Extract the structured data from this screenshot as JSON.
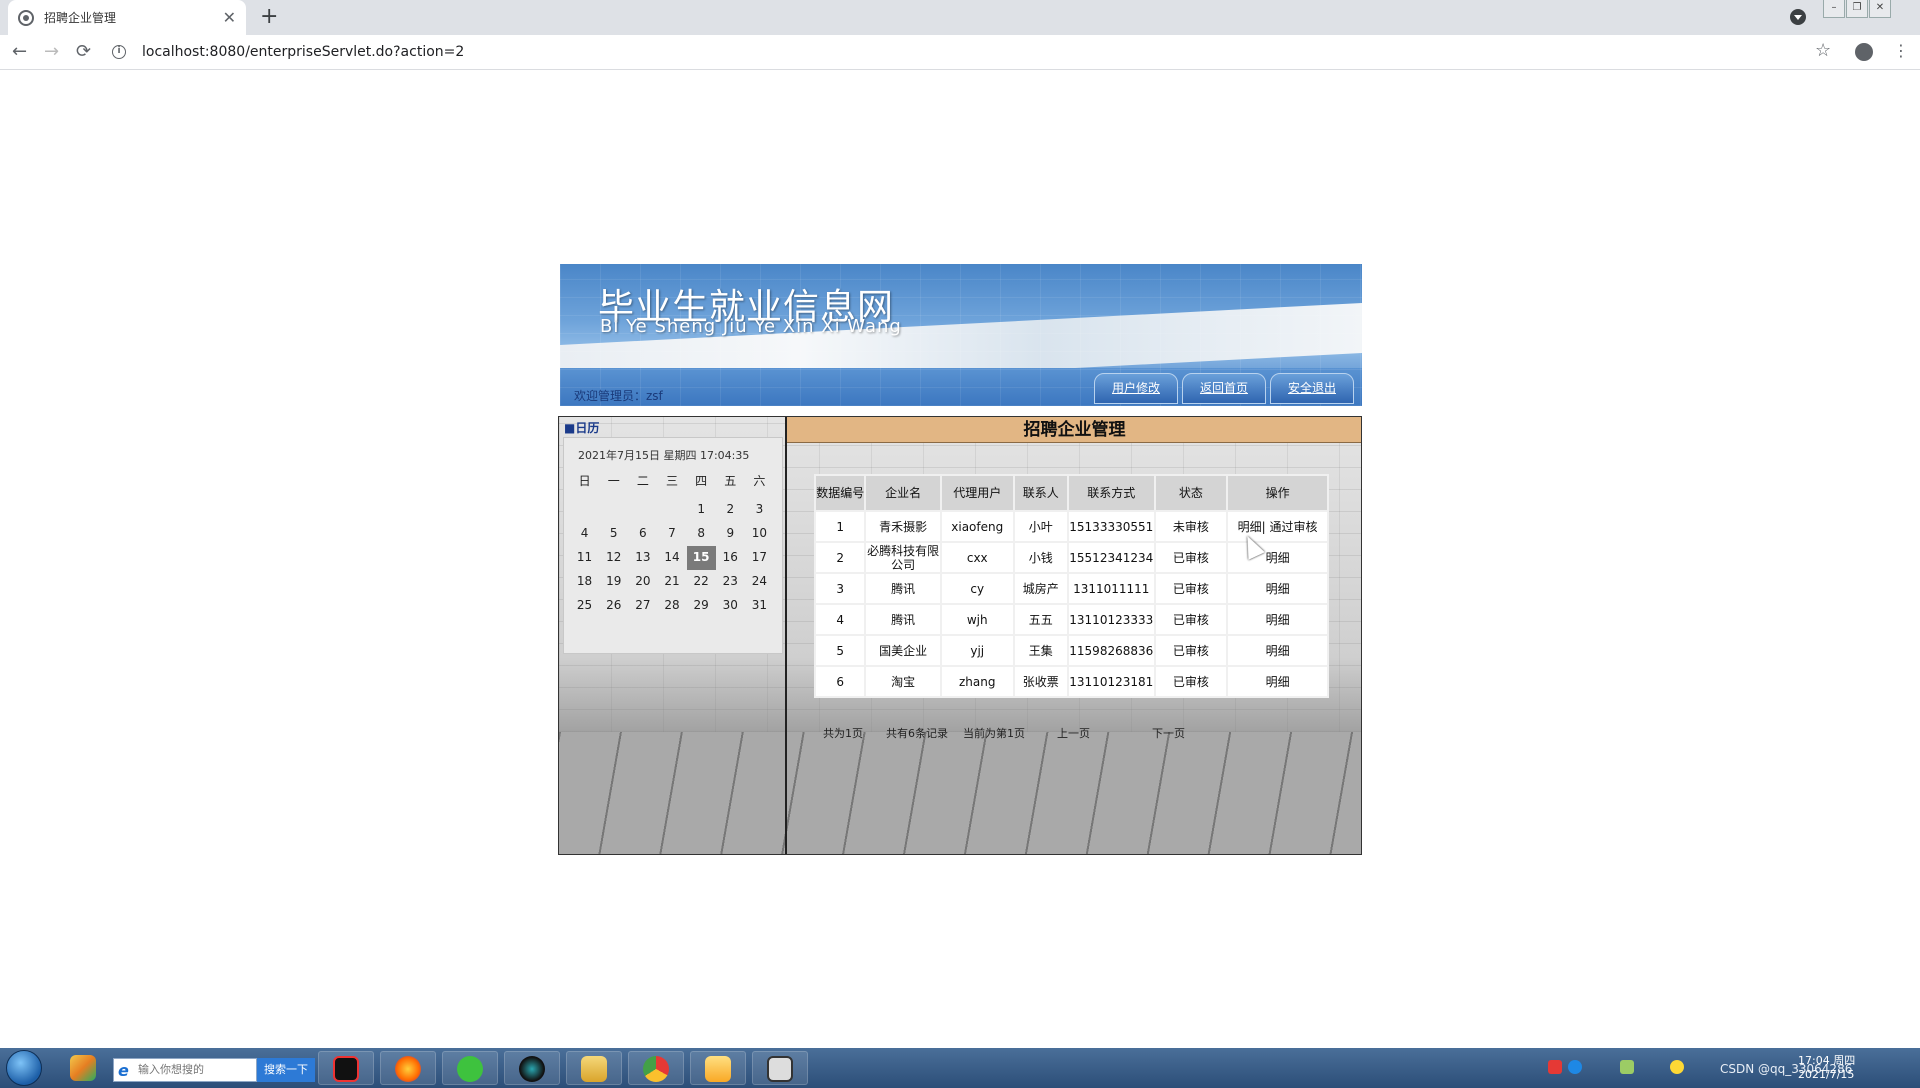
{
  "browser": {
    "tab_title": "招聘企业管理",
    "tab_close": "✕",
    "new_tab": "+",
    "url": "localhost:8080/enterpriseServlet.do?action=2",
    "back": "←",
    "forward": "→",
    "reload": "⟳",
    "star": "☆",
    "menu": "⋮",
    "info": "i"
  },
  "banner": {
    "title": "毕业生就业信息网",
    "subtitle": "Bi Ye Sheng Jiu Ye Xin Xi Wang",
    "welcome": "欢迎管理员：zsf",
    "buttons": [
      "用户修改",
      "返回首页",
      "安全退出"
    ]
  },
  "calendar": {
    "heading": "■日历",
    "datetime": "2021年7月15日 星期四  17:04:35",
    "weekdays": [
      "日",
      "一",
      "二",
      "三",
      "四",
      "五",
      "六"
    ],
    "weeks": [
      [
        "",
        "",
        "",
        "",
        "1",
        "2",
        "3"
      ],
      [
        "4",
        "5",
        "6",
        "7",
        "8",
        "9",
        "10"
      ],
      [
        "11",
        "12",
        "13",
        "14",
        "15",
        "16",
        "17"
      ],
      [
        "18",
        "19",
        "20",
        "21",
        "22",
        "23",
        "24"
      ],
      [
        "25",
        "26",
        "27",
        "28",
        "29",
        "30",
        "31"
      ]
    ],
    "today": "15"
  },
  "main": {
    "title": "招聘企业管理",
    "columns": [
      "数据编号",
      "企业名",
      "代理用户",
      "联系人",
      "联系方式",
      "状态",
      "操作"
    ],
    "rows": [
      {
        "id": "1",
        "company": "青禾摄影",
        "agent": "xiaofeng",
        "contact": "小叶",
        "phone": "15133330551",
        "status": "未审核",
        "ops": [
          "明细",
          "通过审核"
        ]
      },
      {
        "id": "2",
        "company": "必腾科技有限公司",
        "agent": "cxx",
        "contact": "小钱",
        "phone": "15512341234",
        "status": "已审核",
        "ops": [
          "明细"
        ]
      },
      {
        "id": "3",
        "company": "腾讯",
        "agent": "cy",
        "contact": "城房产",
        "phone": "1311011111",
        "status": "已审核",
        "ops": [
          "明细"
        ]
      },
      {
        "id": "4",
        "company": "腾讯",
        "agent": "wjh",
        "contact": "五五",
        "phone": "13110123333",
        "status": "已审核",
        "ops": [
          "明细"
        ]
      },
      {
        "id": "5",
        "company": "国美企业",
        "agent": "yjj",
        "contact": "王集",
        "phone": "11598268836",
        "status": "已审核",
        "ops": [
          "明细"
        ]
      },
      {
        "id": "6",
        "company": "淘宝",
        "agent": "zhang",
        "contact": "张收票",
        "phone": "13110123181",
        "status": "已审核",
        "ops": [
          "明细"
        ]
      }
    ],
    "pager": {
      "total_pages": "共为1页",
      "total_records": "共有6条记录",
      "current_page": "当前为第1页",
      "prev": "上一页",
      "next": "下一页"
    }
  },
  "taskbar": {
    "search_placeholder": "输入你想搜的",
    "search_button": "搜索一下",
    "tray_text": "CSDN @qq_33064286",
    "clock_time": "17:04 周四",
    "clock_date": "2021/7/15"
  },
  "colors": {
    "title_bar": "#e2b684",
    "header_cell": "#d4d4d4",
    "taskbar": "#2c4e78"
  }
}
